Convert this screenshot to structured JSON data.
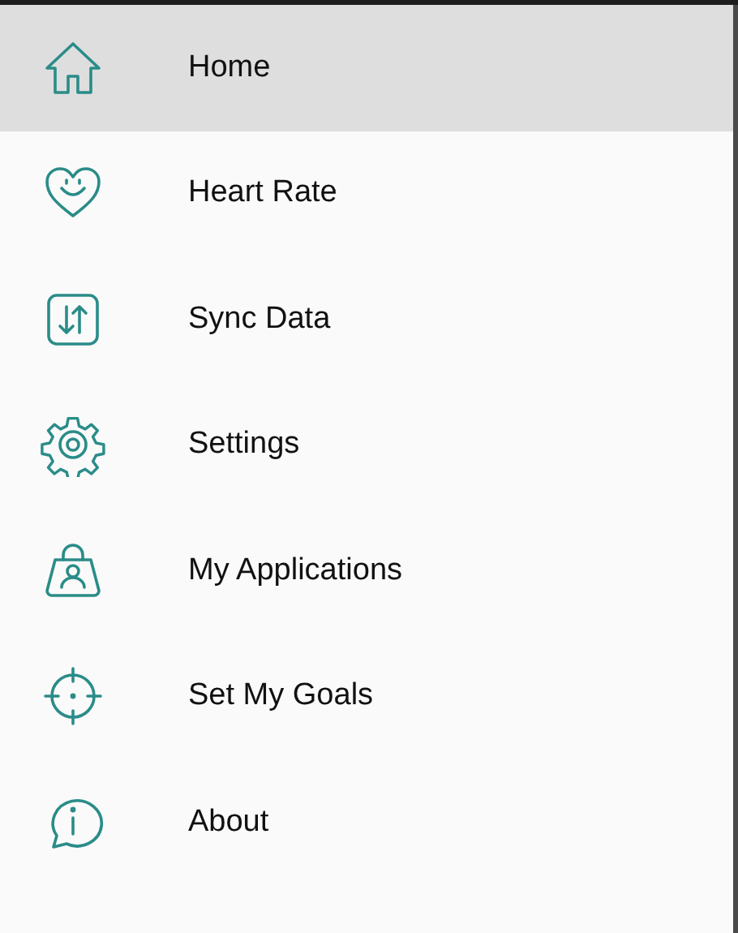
{
  "menu": {
    "items": [
      {
        "label": "Home",
        "selected": true
      },
      {
        "label": "Heart Rate",
        "selected": false
      },
      {
        "label": "Sync Data",
        "selected": false
      },
      {
        "label": "Settings",
        "selected": false
      },
      {
        "label": "My Applications",
        "selected": false
      },
      {
        "label": "Set My Goals",
        "selected": false
      },
      {
        "label": "About",
        "selected": false
      }
    ]
  }
}
